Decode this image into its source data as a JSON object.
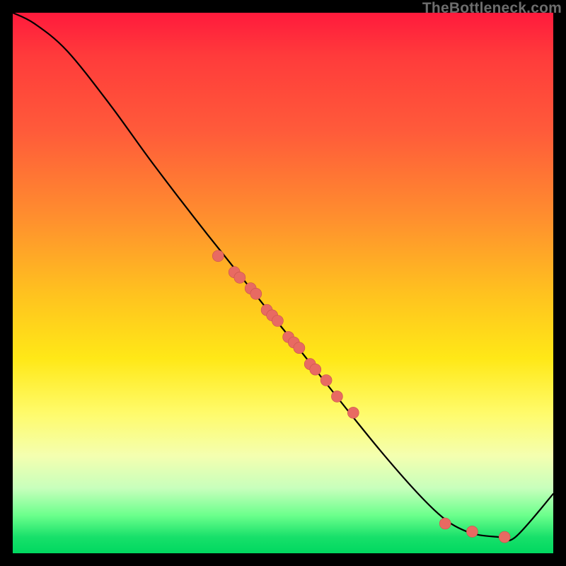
{
  "attribution": "TheBottleneck.com",
  "colors": {
    "attribution": "#6d6d6d",
    "curve": "#000000",
    "dot_fill": "#e86a62",
    "dot_stroke": "#c9534b",
    "frame": "#000000",
    "gradient_stops": [
      "#ff1a3c",
      "#ff3b3b",
      "#ff5b3a",
      "#ff8f2e",
      "#ffc21f",
      "#ffe817",
      "#fffb6a",
      "#f4ffb0",
      "#c7ffbc",
      "#6bff8c",
      "#18e06a",
      "#00d860"
    ]
  },
  "chart_data": {
    "type": "line",
    "title": "",
    "xlabel": "",
    "ylabel": "",
    "xlim": [
      0,
      100
    ],
    "ylim": [
      0,
      100
    ],
    "note": "Axes are unlabeled; x/y expressed as 0–100 percent of the plotting area (origin bottom-left). Curve descends from top-left, flattens near y≈3 forming a trough around x≈80–92, then rises toward bottom-right corner.",
    "series": [
      {
        "name": "curve",
        "x": [
          0,
          4,
          10,
          18,
          26,
          36,
          52,
          68,
          78,
          84,
          90,
          93,
          100
        ],
        "y": [
          100,
          98,
          93,
          83,
          72,
          59,
          39,
          19,
          8,
          4,
          3,
          3,
          11
        ],
        "style": "line"
      },
      {
        "name": "cluster-points",
        "x": [
          38,
          41,
          42,
          44,
          45,
          47,
          48,
          49,
          51,
          52,
          53,
          55,
          56,
          58,
          60,
          63,
          80,
          85,
          91
        ],
        "y": [
          55,
          52,
          51,
          49,
          48,
          45,
          44,
          43,
          40,
          39,
          38,
          35,
          34,
          32,
          29,
          26,
          5.5,
          4,
          3
        ],
        "style": "scatter"
      }
    ]
  }
}
